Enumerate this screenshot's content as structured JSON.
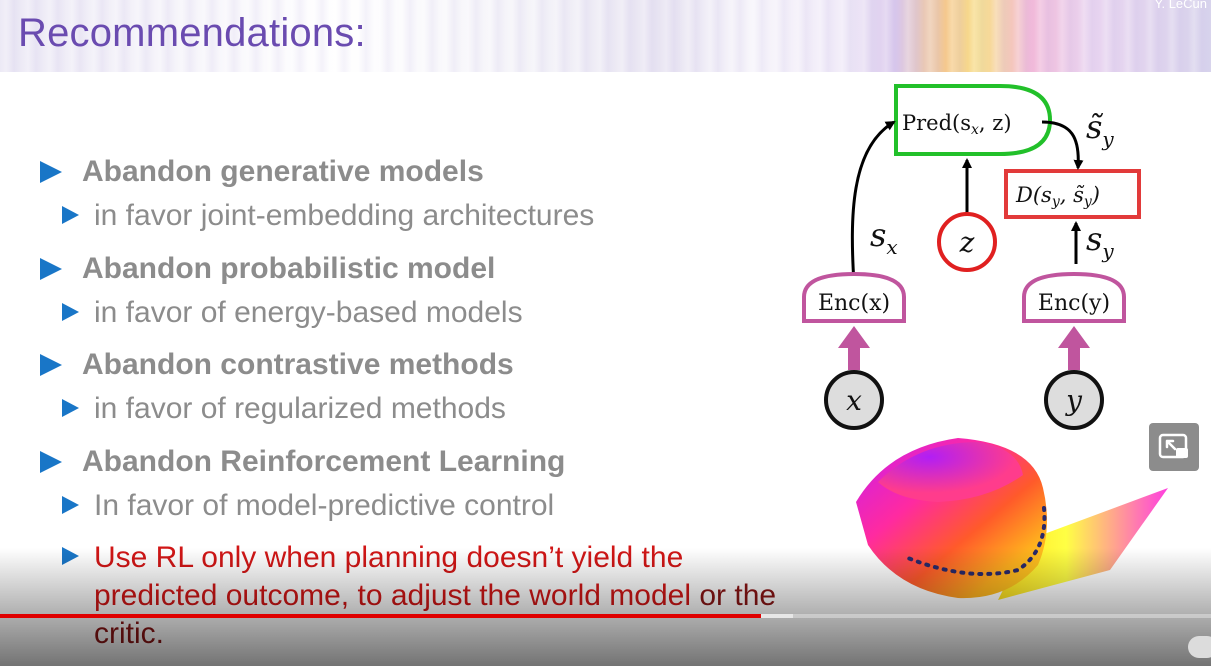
{
  "header": {
    "title": "Recommendations:",
    "author": "Y. LeCun"
  },
  "bullets": [
    {
      "level": 1,
      "text": "Abandon generative models"
    },
    {
      "level": 2,
      "text": "in favor joint-embedding architectures"
    },
    {
      "level": 1,
      "text": "Abandon probabilistic model"
    },
    {
      "level": 2,
      "text": "in favor of energy-based models"
    },
    {
      "level": 1,
      "text": "Abandon contrastive methods"
    },
    {
      "level": 2,
      "text": "in favor of regularized methods"
    },
    {
      "level": 1,
      "text": "Abandon Reinforcement Learning"
    },
    {
      "level": 2,
      "text": "In favor of model-predictive control"
    },
    {
      "level": 2,
      "text_a": "Use RL only when planning doesn’t yield the predicted outcome, to adjust the world model ",
      "text_b": "or the critic."
    }
  ],
  "diagram": {
    "pred": "Pred(s",
    "pred_sub": "x",
    "pred_tail": ", z)",
    "sy_tilde": "s̃",
    "sy_tilde_sub": "y",
    "energy": "D(s",
    "energy_sub1": "y",
    "energy_mid": ", s̃",
    "energy_sub2": "y",
    "energy_tail": ")",
    "sx": "s",
    "sx_sub": "x",
    "sy": "s",
    "sy_sub": "y",
    "z": "z",
    "enc_x": "Enc(x)",
    "enc_y": "Enc(y)",
    "x": "x",
    "y": "y",
    "colors": {
      "pred": "#22c02a",
      "energy": "#e23a3a",
      "latent": "#e02020",
      "encoder": "#c0559e",
      "input_fill": "#dddddd"
    }
  },
  "player": {
    "progress": 0.628,
    "buffered": 0.655,
    "pip_icon": "picture-in-picture-icon",
    "progress_color": "#e00000"
  }
}
